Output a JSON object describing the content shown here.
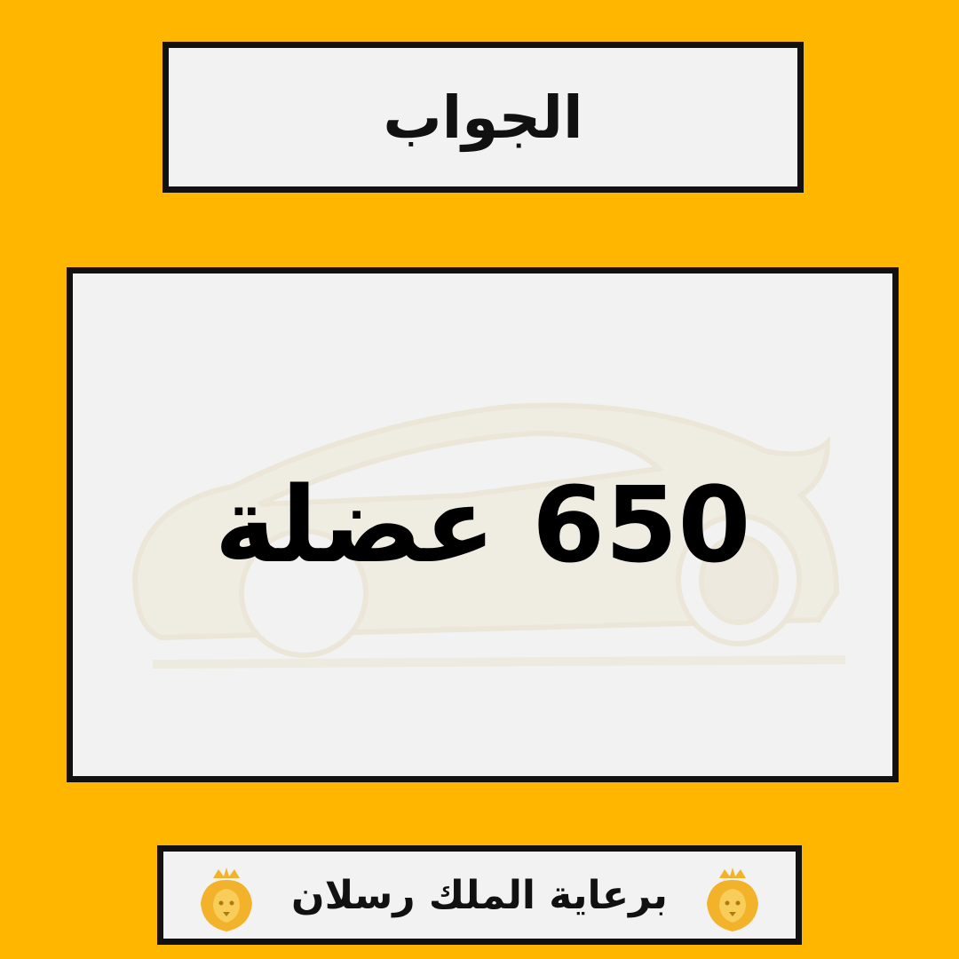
{
  "header": {
    "title": "الجواب"
  },
  "answer": {
    "text": "650 عضلة"
  },
  "footer": {
    "sponsor_text": "برعاية الملك رسلان"
  },
  "icons": {
    "watermark": "car-silhouette-icon",
    "emblem": "lion-head-icon"
  },
  "colors": {
    "background": "#FEB600",
    "panel": "#F2F2F2",
    "border": "#111111",
    "emblem": "#F2B22A"
  }
}
